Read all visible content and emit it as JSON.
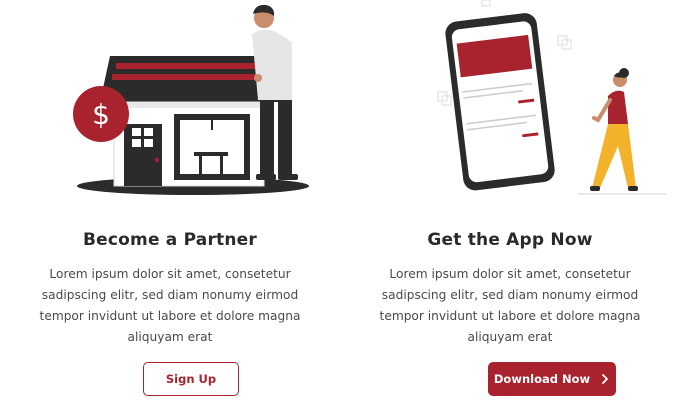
{
  "partner": {
    "title": "Become a Partner",
    "body": "Lorem ipsum dolor sit amet, consetetur sadipscing elitr, sed diam nonumy eirmod tempor invidunt ut labore et dolore magna aliquyam erat",
    "button_label": "Sign Up",
    "currency_symbol": "$"
  },
  "app": {
    "title": "Get the App Now",
    "body": "Lorem ipsum dolor sit amet, consetetur sadipscing elitr, sed diam nonumy eirmod tempor invidunt ut labore et dolore magna aliquyam erat",
    "button_label": "Download Now",
    "button_icon": "chevron-right-icon"
  },
  "colors": {
    "accent": "#a8232e",
    "dark": "#2b2b2b",
    "yellow": "#f2b22a"
  }
}
